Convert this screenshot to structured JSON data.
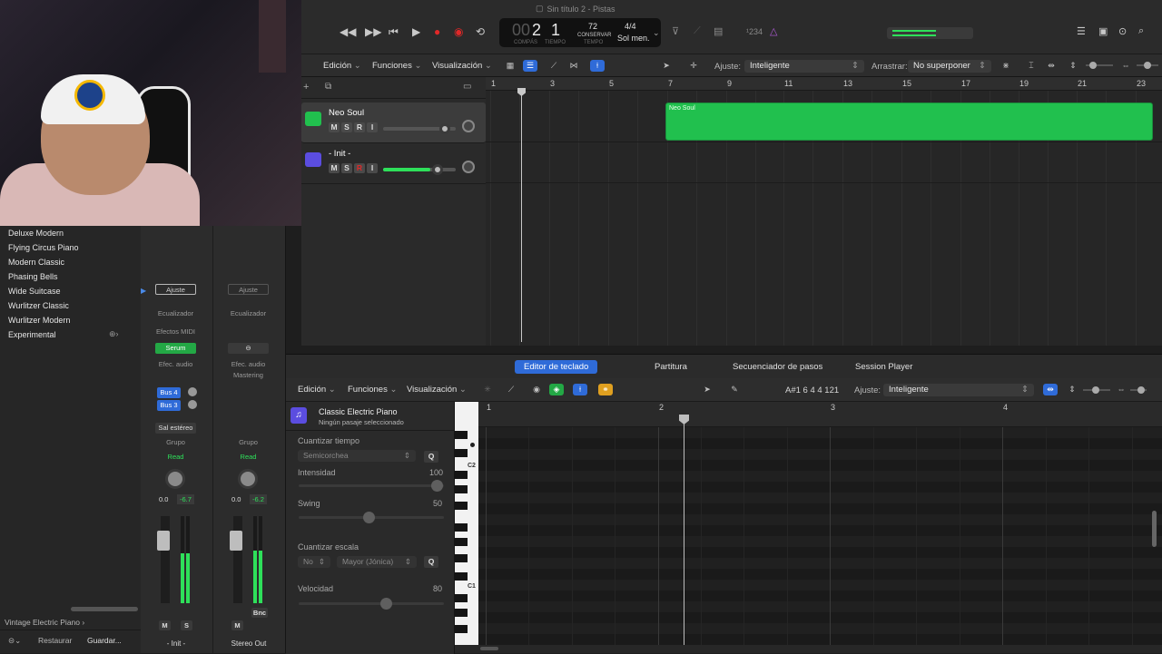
{
  "window": {
    "title": "Sin título 2 - Pistas"
  },
  "transport": {
    "bar": "2",
    "beat": "1",
    "bar_label": "COMPÁS",
    "beat_label": "TIEMPO",
    "tempo": "72",
    "tempo_mode": "CONSERVAR",
    "tempo_label": "TEMPO",
    "time_signature": "4/4",
    "key": "Sol men.",
    "lcd_mode": "¹234"
  },
  "tracks_toolbar": {
    "menus": [
      "Edición",
      "Funciones",
      "Visualización"
    ],
    "snap_label": "Ajuste:",
    "snap_value": "Inteligente",
    "drag_label": "Arrastrar:",
    "drag_value": "No superponer"
  },
  "ruler": [
    "1",
    "3",
    "5",
    "7",
    "9",
    "11",
    "13",
    "15",
    "17",
    "19",
    "21",
    "23"
  ],
  "tracks": [
    {
      "name": "Neo Soul",
      "controls": [
        "M",
        "S",
        "R",
        "I"
      ],
      "volume": 0.7,
      "color": "#21c04e"
    },
    {
      "name": "- Init -",
      "controls": [
        "M",
        "S",
        "R",
        "I"
      ],
      "volume": 0.7,
      "color": "#5b4de0"
    }
  ],
  "regions": [
    {
      "name": "Neo Soul",
      "color": "#21c04e"
    }
  ],
  "library": {
    "items": [
      "Deluxe Modern",
      "Flying Circus Piano",
      "Modern Classic",
      "Phasing Bells",
      "Wide Suitcase",
      "Wurlitzer Classic",
      "Wurlitzer Modern",
      "Experimental"
    ],
    "breadcrumb": "Vintage Electric Piano",
    "restore": "Restaurar",
    "save": "Guardar..."
  },
  "strips": [
    {
      "setting": "Ajuste",
      "eq": "Ecualizador",
      "midi_fx": "Efectos MIDI",
      "instrument": "Serum",
      "audio_fx": "Efec. audio",
      "sends": [
        "Bus 4",
        "Bus 3"
      ],
      "output": "Sal estéreo",
      "group": "Grupo",
      "automation": "Read",
      "vol_db": "0.0",
      "peak_db": "-6.7",
      "buttons": [
        "M",
        "S"
      ],
      "name": "- Init -"
    },
    {
      "setting": "Ajuste",
      "eq": "Ecualizador",
      "audio_fx": "Efec. audio",
      "mastering": "Mastering",
      "group": "Grupo",
      "automation": "Read",
      "vol_db": "0.0",
      "peak_db": "-6.2",
      "buttons": [
        "M"
      ],
      "bounce": "Bnc",
      "name": "Stereo Out"
    }
  ],
  "editor": {
    "tabs": [
      "Editor de teclado",
      "Partitura",
      "Secuenciador de pasos",
      "Session Player"
    ],
    "menus": [
      "Edición",
      "Funciones",
      "Visualización"
    ],
    "position": "A#1  6 4 4 121",
    "snap_label": "Ajuste:",
    "snap_value": "Inteligente",
    "region_name": "Classic Electric Piano",
    "region_sub": "Ningún pasaje seleccionado",
    "quantize_time_label": "Cuantizar tiempo",
    "quantize_time_value": "Semicorchea",
    "intensity_label": "Intensidad",
    "intensity_value": "100",
    "swing_label": "Swing",
    "swing_value": "50",
    "quantize_scale_label": "Cuantizar escala",
    "quantize_scale_value": "No",
    "scale_value": "Mayor (Jónica)",
    "velocity_label": "Velocidad",
    "velocity_value": "80",
    "q_label": "Q",
    "ruler": [
      "1",
      "2",
      "3",
      "4"
    ],
    "key_labels": [
      "C2",
      "C1"
    ]
  }
}
